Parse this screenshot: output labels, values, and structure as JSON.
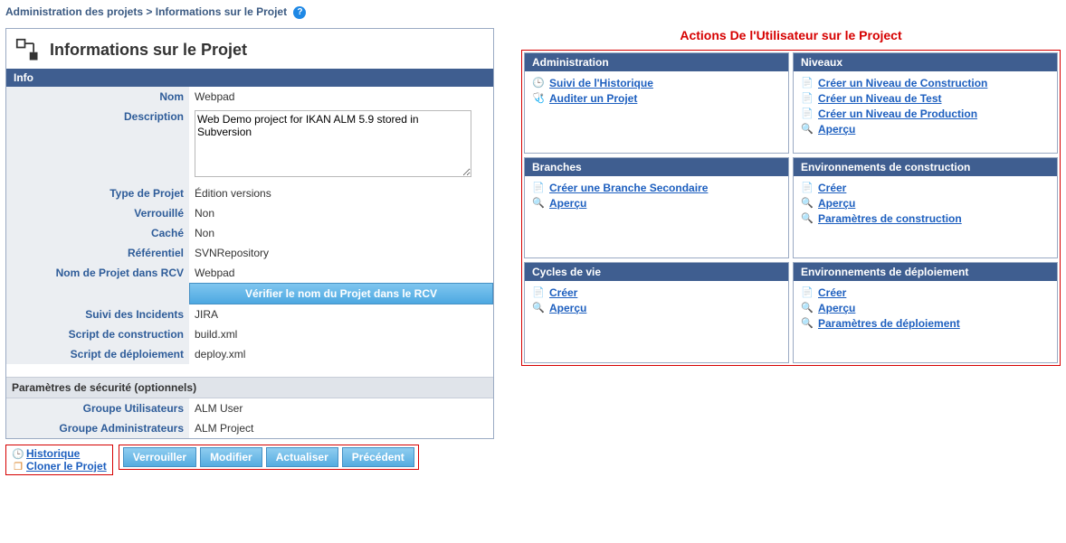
{
  "breadcrumb": {
    "root": "Administration des projets",
    "sep": ">",
    "current": "Informations sur le Projet"
  },
  "panel": {
    "title": "Informations sur le Projet",
    "info_header": "Info",
    "fields": {
      "name_label": "Nom",
      "name_value": "Webpad",
      "desc_label": "Description",
      "desc_value": "Web Demo project for IKAN ALM 5.9 stored in Subversion",
      "type_label": "Type de Projet",
      "type_value": "Édition versions",
      "locked_label": "Verrouillé",
      "locked_value": "Non",
      "hidden_label": "Caché",
      "hidden_value": "Non",
      "repo_label": "Référentiel",
      "repo_value": "SVNRepository",
      "rcvname_label": "Nom de Projet dans RCV",
      "rcvname_value": "Webpad",
      "verify_btn": "Vérifier le nom du Projet dans le RCV",
      "issues_label": "Suivi des Incidents",
      "issues_value": "JIRA",
      "build_label": "Script de construction",
      "build_value": "build.xml",
      "deploy_label": "Script de déploiement",
      "deploy_value": "deploy.xml"
    },
    "security_header": "Paramètres de sécurité (optionnels)",
    "security": {
      "usergroup_label": "Groupe Utilisateurs",
      "usergroup_value": "ALM User",
      "admingroup_label": "Groupe Administrateurs",
      "admingroup_value": "ALM Project"
    }
  },
  "bottom_links": {
    "history": "Historique",
    "clone": "Cloner le Projet"
  },
  "buttons": {
    "lock": "Verrouiller",
    "edit": "Modifier",
    "refresh": "Actualiser",
    "back": "Précédent"
  },
  "right": {
    "title": "Actions De l'Utilisateur sur le Project",
    "cards": {
      "administration": {
        "header": "Administration",
        "items": [
          {
            "icon": "history",
            "label": "Suivi de l'Historique"
          },
          {
            "icon": "audit",
            "label": "Auditer un Projet"
          }
        ]
      },
      "levels": {
        "header": "Niveaux",
        "items": [
          {
            "icon": "doc",
            "label": "Créer un Niveau de Construction"
          },
          {
            "icon": "doc",
            "label": "Créer un Niveau de Test"
          },
          {
            "icon": "doc",
            "label": "Créer un Niveau de Production"
          },
          {
            "icon": "mag",
            "label": "Aperçu"
          }
        ]
      },
      "branches": {
        "header": "Branches",
        "items": [
          {
            "icon": "doc",
            "label": "Créer une Branche Secondaire"
          },
          {
            "icon": "mag",
            "label": "Aperçu"
          }
        ]
      },
      "buildenv": {
        "header": "Environnements de construction",
        "items": [
          {
            "icon": "doc",
            "label": "Créer"
          },
          {
            "icon": "mag",
            "label": "Aperçu"
          },
          {
            "icon": "mag",
            "label": "Paramètres de construction"
          }
        ]
      },
      "lifecycles": {
        "header": "Cycles de vie",
        "items": [
          {
            "icon": "doc",
            "label": "Créer"
          },
          {
            "icon": "mag",
            "label": "Aperçu"
          }
        ]
      },
      "deployenv": {
        "header": "Environnements de déploiement",
        "items": [
          {
            "icon": "doc",
            "label": "Créer"
          },
          {
            "icon": "mag",
            "label": "Aperçu"
          },
          {
            "icon": "mag",
            "label": "Paramètres de déploiement"
          }
        ]
      }
    }
  }
}
